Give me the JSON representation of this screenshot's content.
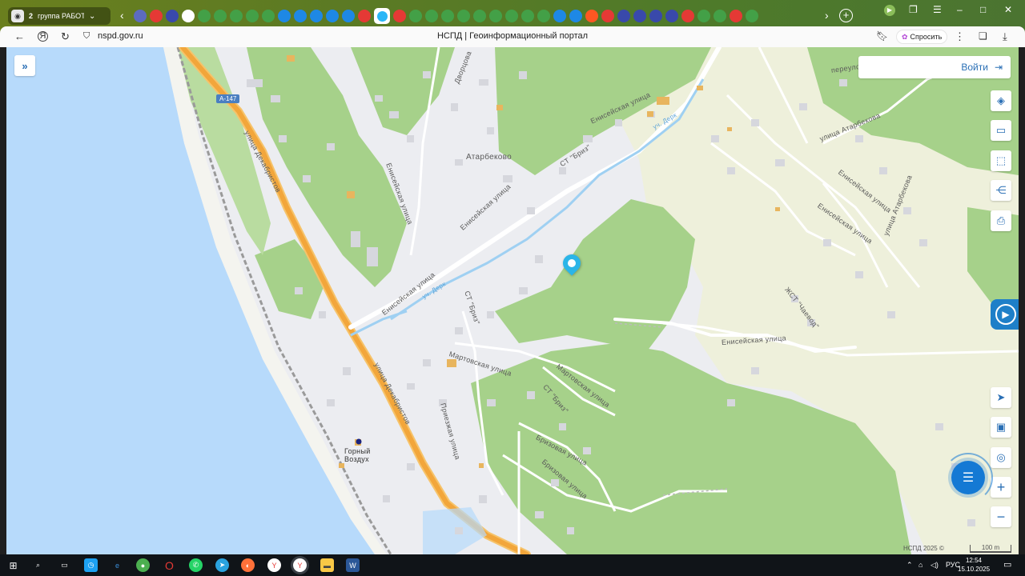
{
  "browser": {
    "tab_group_count": "2",
    "tab_group_label": "группа РАБОТА",
    "url": "nspd.gov.ru",
    "page_title": "НСПД | Геоинформационный портал",
    "ask_label": "Спросить",
    "accent": "#5b7a24"
  },
  "favs": [
    "#5c6bc0",
    "#e53935",
    "#3949ab",
    "#ffffff",
    "#43a047",
    "#43a047",
    "#43a047",
    "#43a047",
    "#43a047",
    "#1e88e5",
    "#1e88e5",
    "#1e88e5",
    "#1e88e5",
    "#1e88e5",
    "#e53935",
    "#29b6f6",
    "#e53935",
    "#43a047",
    "#43a047",
    "#43a047",
    "#43a047",
    "#43a047",
    "#43a047",
    "#43a047",
    "#43a047",
    "#43a047",
    "#1e88e5",
    "#1e88e5",
    "#ff5722",
    "#e53935",
    "#3949ab",
    "#3949ab",
    "#3949ab",
    "#3949ab",
    "#e53935",
    "#43a047",
    "#43a047",
    "#e53935",
    "#43a047"
  ],
  "map": {
    "login_label": "Войти",
    "highway_badge": "А-147",
    "copyright": "НСПД 2025 ©",
    "scale": "100 m",
    "labels": {
      "atarbekovo": "Атарбеково",
      "dekabristov1": "улица Декабристов",
      "dekabristov2": "улица Декабристов",
      "eniseyskaya1": "Енисейская улица",
      "eniseyskaya2": "Енисейская улица",
      "eniseyskaya3": "Енисейская улица",
      "eniseyskaya4": "Енисейская улица",
      "eniseyskaya5": "Енисейская улица",
      "eniseyskaya6": "Енисейская улица",
      "eniseyskaya7": "Енисейская улица",
      "st_briz1": "СТ \"Бриз\"",
      "st_briz2": "СТ \"Бриз\"",
      "st_briz3": "СТ \"Бриз\"",
      "atarbekova1": "улица Атарбекова",
      "atarbekova2": "улица Атарбекова",
      "martovskaya1": "Мартовская улица",
      "martovskaya2": "Мартовская улица",
      "prezhaznaya": "Приезжая улица",
      "brizovaya1": "Бризовая улица",
      "brizovaya2": "Бризовая улица",
      "gorny_vozdukh": "Горный Воздух",
      "zht_chaevod": "ЖСТ \"Чаевод\"",
      "pereulok": "переулок",
      "dvortsovaya": "Дворцова",
      "uch_derk1": "уч. Дерк",
      "uch_derk2": "уч. Дерк"
    }
  },
  "taskbar": {
    "lang": "РУС",
    "time": "12:54",
    "date": "15.10.2025"
  }
}
